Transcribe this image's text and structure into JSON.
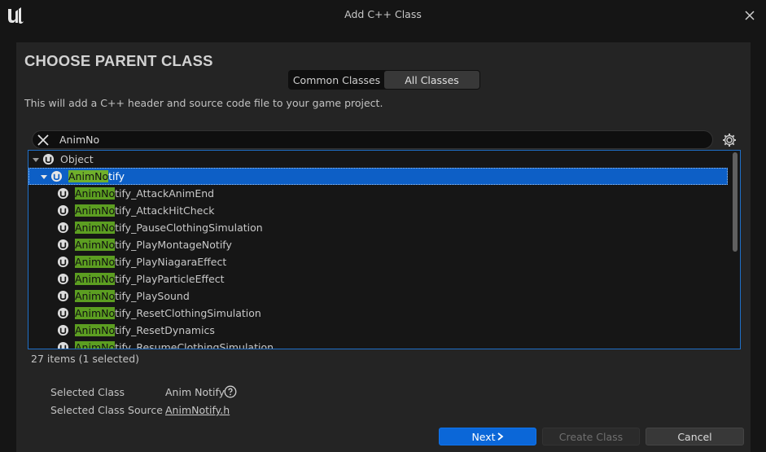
{
  "window": {
    "title": "Add C++ Class",
    "logo_icon": "unreal-logo-icon",
    "close_icon": "close-icon"
  },
  "dialog": {
    "heading": "CHOOSE PARENT CLASS",
    "tabs": [
      {
        "label": "Common Classes",
        "active": false
      },
      {
        "label": "All Classes",
        "active": true
      }
    ],
    "description": "This will add a C++ header and source code file to your game project."
  },
  "search": {
    "value": "AnimNo",
    "clear_icon": "close-icon",
    "settings_icon": "gear-icon"
  },
  "tree": {
    "root": {
      "label": "Object",
      "expanded": true
    },
    "selected_node": {
      "label_match": "AnimNo",
      "label_rest": "tify",
      "expanded": true
    },
    "children": [
      {
        "match": "AnimNo",
        "rest": "tify_AttackAnimEnd"
      },
      {
        "match": "AnimNo",
        "rest": "tify_AttackHitCheck"
      },
      {
        "match": "AnimNo",
        "rest": "tify_PauseClothingSimulation"
      },
      {
        "match": "AnimNo",
        "rest": "tify_PlayMontageNotify"
      },
      {
        "match": "AnimNo",
        "rest": "tify_PlayNiagaraEffect"
      },
      {
        "match": "AnimNo",
        "rest": "tify_PlayParticleEffect"
      },
      {
        "match": "AnimNo",
        "rest": "tify_PlaySound"
      },
      {
        "match": "AnimNo",
        "rest": "tify_ResetClothingSimulation"
      },
      {
        "match": "AnimNo",
        "rest": "tify_ResetDynamics"
      },
      {
        "match": "AnimNo",
        "rest": "tify_ResumeClothingSimulation"
      }
    ],
    "class_icon": "unreal-class-icon",
    "item_count": "27 items (1 selected)"
  },
  "info": {
    "selected_class_label": "Selected Class",
    "selected_class_value": "Anim Notify",
    "help_icon": "question-circle-icon",
    "source_label": "Selected Class Source",
    "source_value": "AnimNotify.h"
  },
  "buttons": {
    "next": "Next",
    "next_icon": "chevron-right-icon",
    "create": "Create Class",
    "cancel": "Cancel"
  },
  "colors": {
    "accent": "#0b67d8",
    "selection": "#0d5fc6",
    "match_highlight": "#5c9e21",
    "background": "#242424"
  }
}
